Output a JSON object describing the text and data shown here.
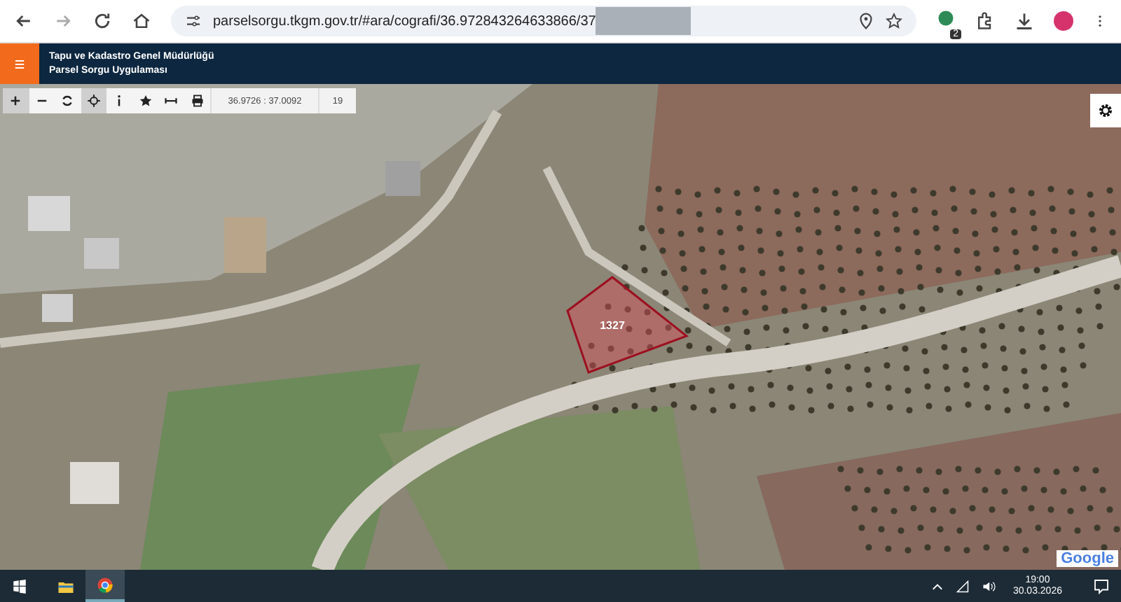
{
  "browser": {
    "url": "parselsorgu.tkgm.gov.tr/#ara/cografi/36.972843264633866/37",
    "extension_badge": "2"
  },
  "header": {
    "title": "Tapu ve Kadastro Genel Müdürlüğü",
    "subtitle": "Parsel Sorgu Uygulaması"
  },
  "toolbar": {
    "tools": [
      {
        "kind": "zoom-in",
        "selected": true
      },
      {
        "kind": "zoom-out",
        "selected": false
      },
      {
        "kind": "refresh",
        "selected": false
      },
      {
        "kind": "locate",
        "selected": true
      },
      {
        "kind": "info",
        "selected": false
      },
      {
        "kind": "favorite",
        "selected": false
      },
      {
        "kind": "measure",
        "selected": false
      },
      {
        "kind": "print",
        "selected": false
      }
    ],
    "coordinates": "36.9726 : 37.0092",
    "zoom": "19"
  },
  "map": {
    "parcel_label": "1327",
    "attribution": "Google"
  },
  "taskbar": {
    "time": "19:00",
    "date": "30.03.2026"
  }
}
